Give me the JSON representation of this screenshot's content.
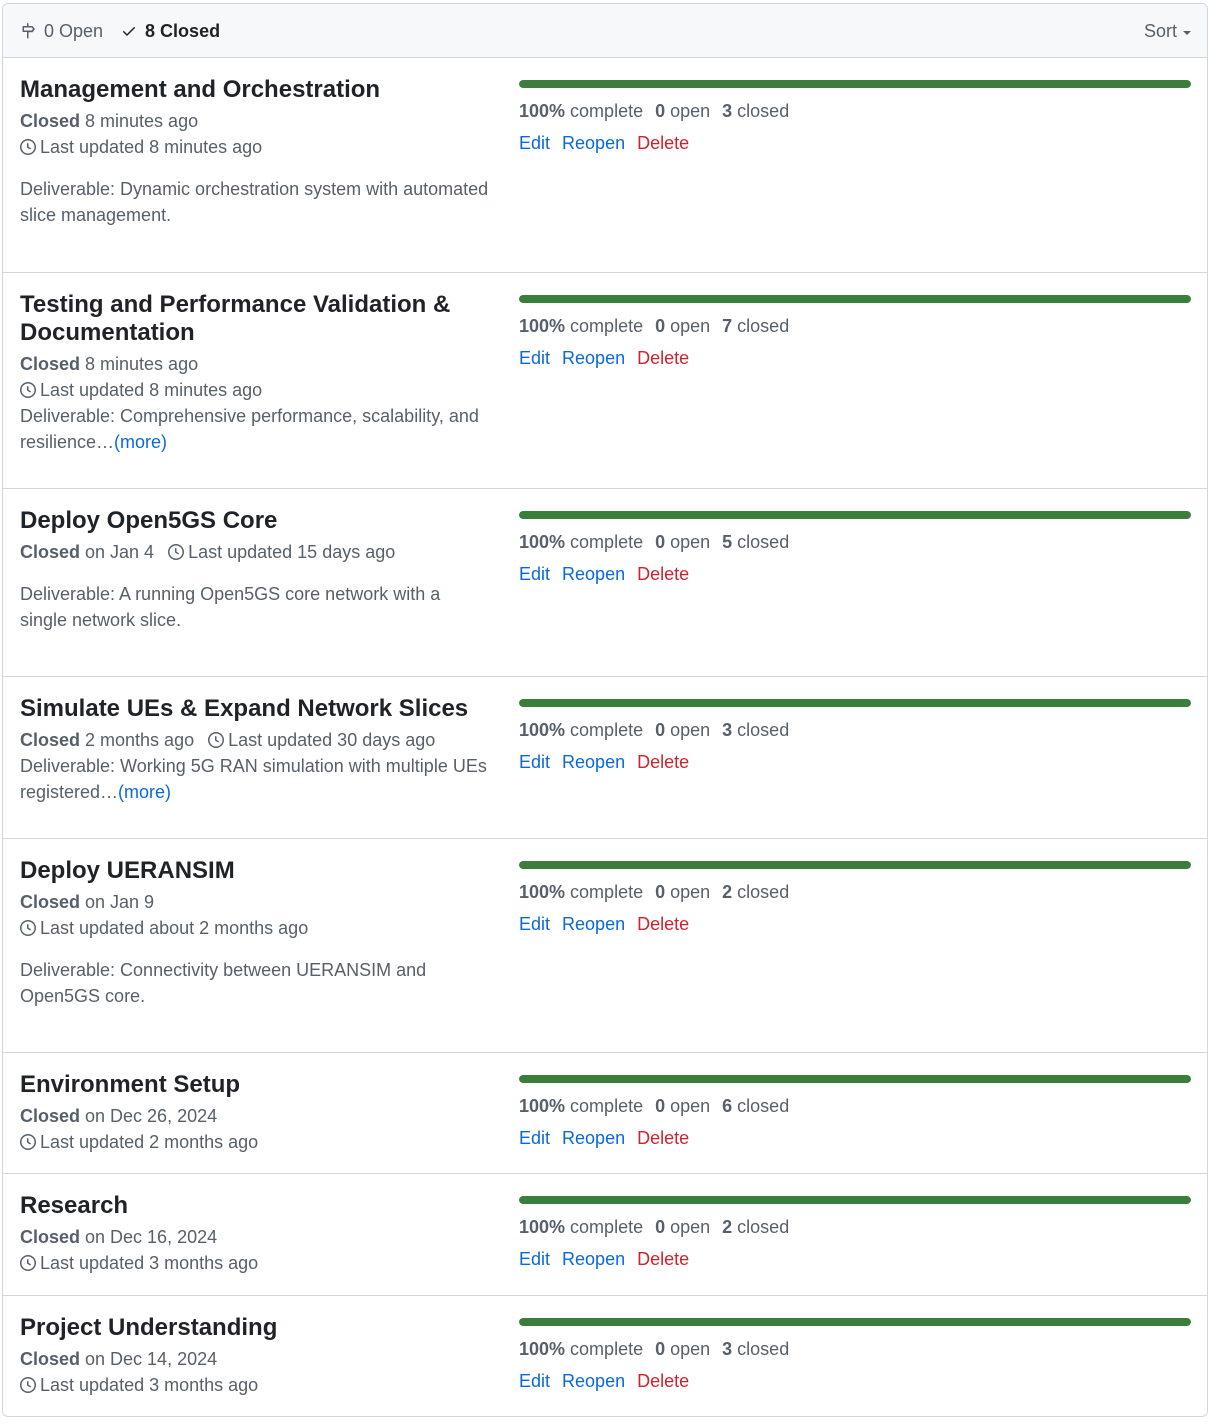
{
  "header": {
    "open_label": "0 Open",
    "closed_label": "8 Closed",
    "sort_label": "Sort"
  },
  "milestones": [
    {
      "title": "Management and Orchestration",
      "closed_prefix": "Closed",
      "closed_text": " 8 minutes ago",
      "updated": "Last updated 8 minutes ago",
      "description": "Deliverable: Dynamic orchestration system with automated slice management.",
      "more": "",
      "progress": 100,
      "percent": "100%",
      "complete_label": " complete",
      "open_count": "0",
      "open_label": " open",
      "closed_count": "3",
      "closed_label": " closed",
      "edit": "Edit",
      "reopen": "Reopen",
      "delete": "Delete"
    },
    {
      "title": "Testing and Performance Validation & Documentation",
      "closed_prefix": "Closed",
      "closed_text": " 8 minutes ago",
      "updated": "Last updated 8 minutes ago",
      "description": "Deliverable: Comprehensive performance, scalability, and resilience…",
      "more": "(more)",
      "progress": 100,
      "percent": "100%",
      "complete_label": " complete",
      "open_count": "0",
      "open_label": " open",
      "closed_count": "7",
      "closed_label": " closed",
      "edit": "Edit",
      "reopen": "Reopen",
      "delete": "Delete"
    },
    {
      "title": "Deploy Open5GS Core",
      "closed_prefix": "Closed",
      "closed_text": " on Jan 4",
      "updated": "Last updated 15 days ago",
      "description": "Deliverable: A running Open5GS core network with a single network slice.",
      "more": "",
      "progress": 100,
      "percent": "100%",
      "complete_label": " complete",
      "open_count": "0",
      "open_label": " open",
      "closed_count": "5",
      "closed_label": " closed",
      "edit": "Edit",
      "reopen": "Reopen",
      "delete": "Delete"
    },
    {
      "title": "Simulate UEs & Expand Network Slices",
      "closed_prefix": "Closed",
      "closed_text": " 2 months ago",
      "updated": "Last updated 30 days ago",
      "description": "Deliverable: Working 5G RAN simulation with multiple UEs registered…",
      "more": "(more)",
      "progress": 100,
      "percent": "100%",
      "complete_label": " complete",
      "open_count": "0",
      "open_label": " open",
      "closed_count": "3",
      "closed_label": " closed",
      "edit": "Edit",
      "reopen": "Reopen",
      "delete": "Delete"
    },
    {
      "title": "Deploy UERANSIM",
      "closed_prefix": "Closed",
      "closed_text": " on Jan 9",
      "updated": "Last updated about 2 months ago",
      "description": "Deliverable: Connectivity between UERANSIM and Open5GS core.",
      "more": "",
      "progress": 100,
      "percent": "100%",
      "complete_label": " complete",
      "open_count": "0",
      "open_label": " open",
      "closed_count": "2",
      "closed_label": " closed",
      "edit": "Edit",
      "reopen": "Reopen",
      "delete": "Delete"
    },
    {
      "title": "Environment Setup",
      "closed_prefix": "Closed",
      "closed_text": " on Dec 26, 2024",
      "updated": "Last updated 2 months ago",
      "description": "",
      "more": "",
      "progress": 100,
      "percent": "100%",
      "complete_label": " complete",
      "open_count": "0",
      "open_label": " open",
      "closed_count": "6",
      "closed_label": " closed",
      "edit": "Edit",
      "reopen": "Reopen",
      "delete": "Delete"
    },
    {
      "title": "Research",
      "closed_prefix": "Closed",
      "closed_text": " on Dec 16, 2024",
      "updated": "Last updated 3 months ago",
      "description": "",
      "more": "",
      "progress": 100,
      "percent": "100%",
      "complete_label": " complete",
      "open_count": "0",
      "open_label": " open",
      "closed_count": "2",
      "closed_label": " closed",
      "edit": "Edit",
      "reopen": "Reopen",
      "delete": "Delete"
    },
    {
      "title": "Project Understanding",
      "closed_prefix": "Closed",
      "closed_text": " on Dec 14, 2024",
      "updated": "Last updated 3 months ago",
      "description": "",
      "more": "",
      "progress": 100,
      "percent": "100%",
      "complete_label": " complete",
      "open_count": "0",
      "open_label": " open",
      "closed_count": "3",
      "closed_label": " closed",
      "edit": "Edit",
      "reopen": "Reopen",
      "delete": "Delete"
    }
  ]
}
